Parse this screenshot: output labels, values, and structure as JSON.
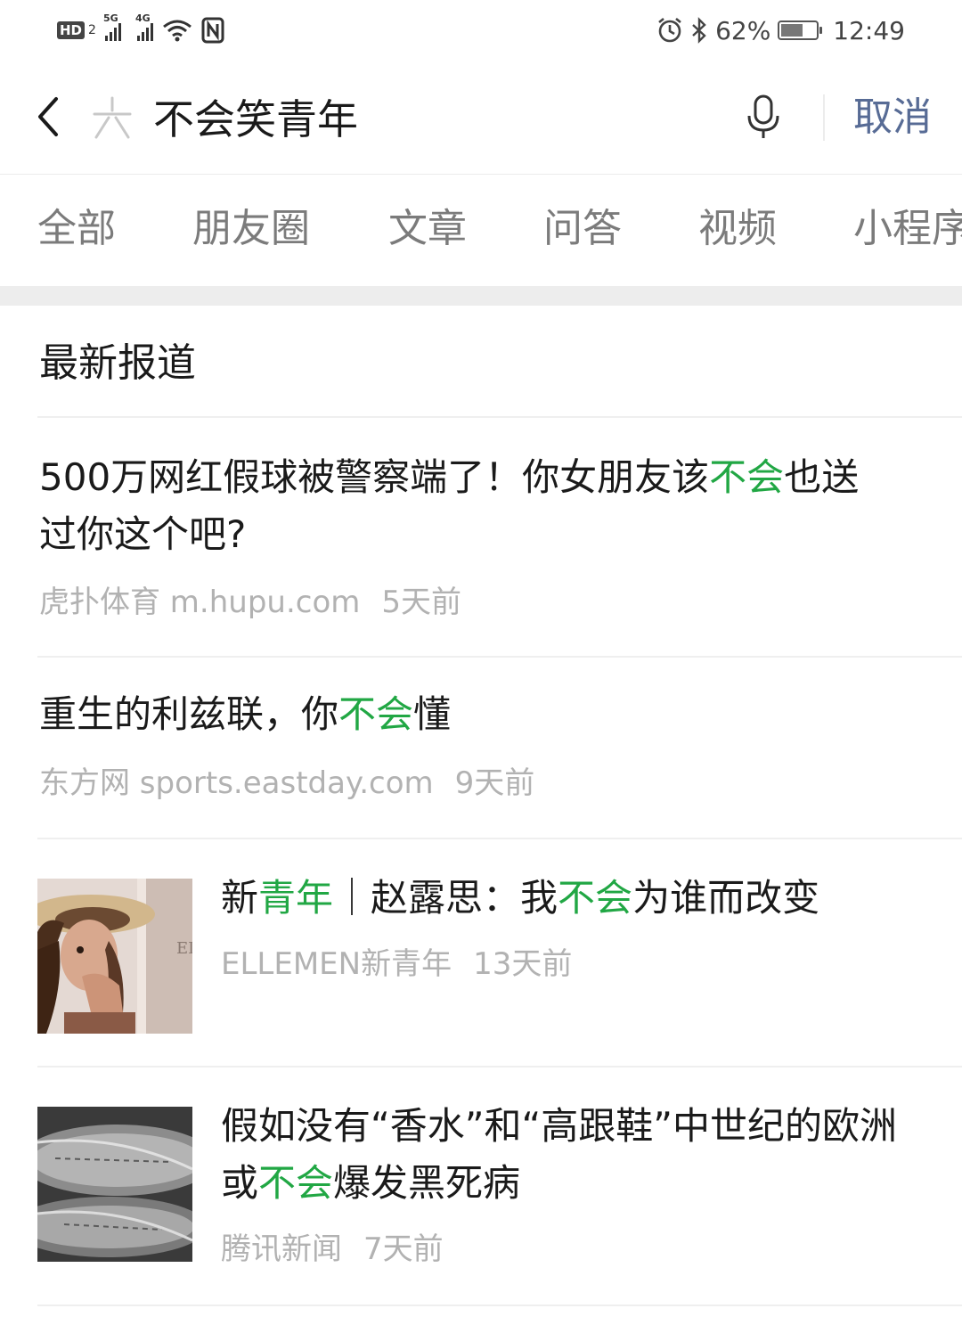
{
  "status_bar": {
    "hd": "HD",
    "sim": "2",
    "net1": "5G",
    "net2": "4G",
    "battery_pct": "62%",
    "battery_level": 0.62,
    "time": "12:49"
  },
  "search": {
    "query": "不会笑青年",
    "cancel_label": "取消"
  },
  "tabs": [
    "全部",
    "朋友圈",
    "文章",
    "问答",
    "视频",
    "小程序"
  ],
  "section_title": "最新报道",
  "results": [
    {
      "title_parts": [
        {
          "text": "500万网红假球被警察端了！你女朋友该",
          "hl": false
        },
        {
          "text": "不会",
          "hl": true
        },
        {
          "text": "也送过你这个吧?",
          "hl": false
        }
      ],
      "source": "虎扑体育 m.hupu.com",
      "time": "5天前"
    },
    {
      "title_parts": [
        {
          "text": "重生的利兹联，你",
          "hl": false
        },
        {
          "text": "不会",
          "hl": true
        },
        {
          "text": "懂",
          "hl": false
        }
      ],
      "source": "东方网 sports.eastday.com",
      "time": "9天前"
    },
    {
      "title_parts": [
        {
          "text": "新",
          "hl": false
        },
        {
          "text": "青年",
          "hl": true
        },
        {
          "text": "｜赵露思：我",
          "hl": false
        },
        {
          "text": "不会",
          "hl": true
        },
        {
          "text": "为谁而改变",
          "hl": false
        }
      ],
      "source": "ELLEMEN新青年",
      "time": "13天前"
    },
    {
      "title_parts": [
        {
          "text": "假如没有“香水”和“高跟鞋”中世纪的欧洲或",
          "hl": false
        },
        {
          "text": "不会",
          "hl": true
        },
        {
          "text": "爆发黑死病",
          "hl": false
        }
      ],
      "source": "腾讯新闻",
      "time": "7天前"
    }
  ],
  "colors": {
    "highlight": "#21a744",
    "link": "#576b95",
    "meta": "#b2b2b2"
  }
}
